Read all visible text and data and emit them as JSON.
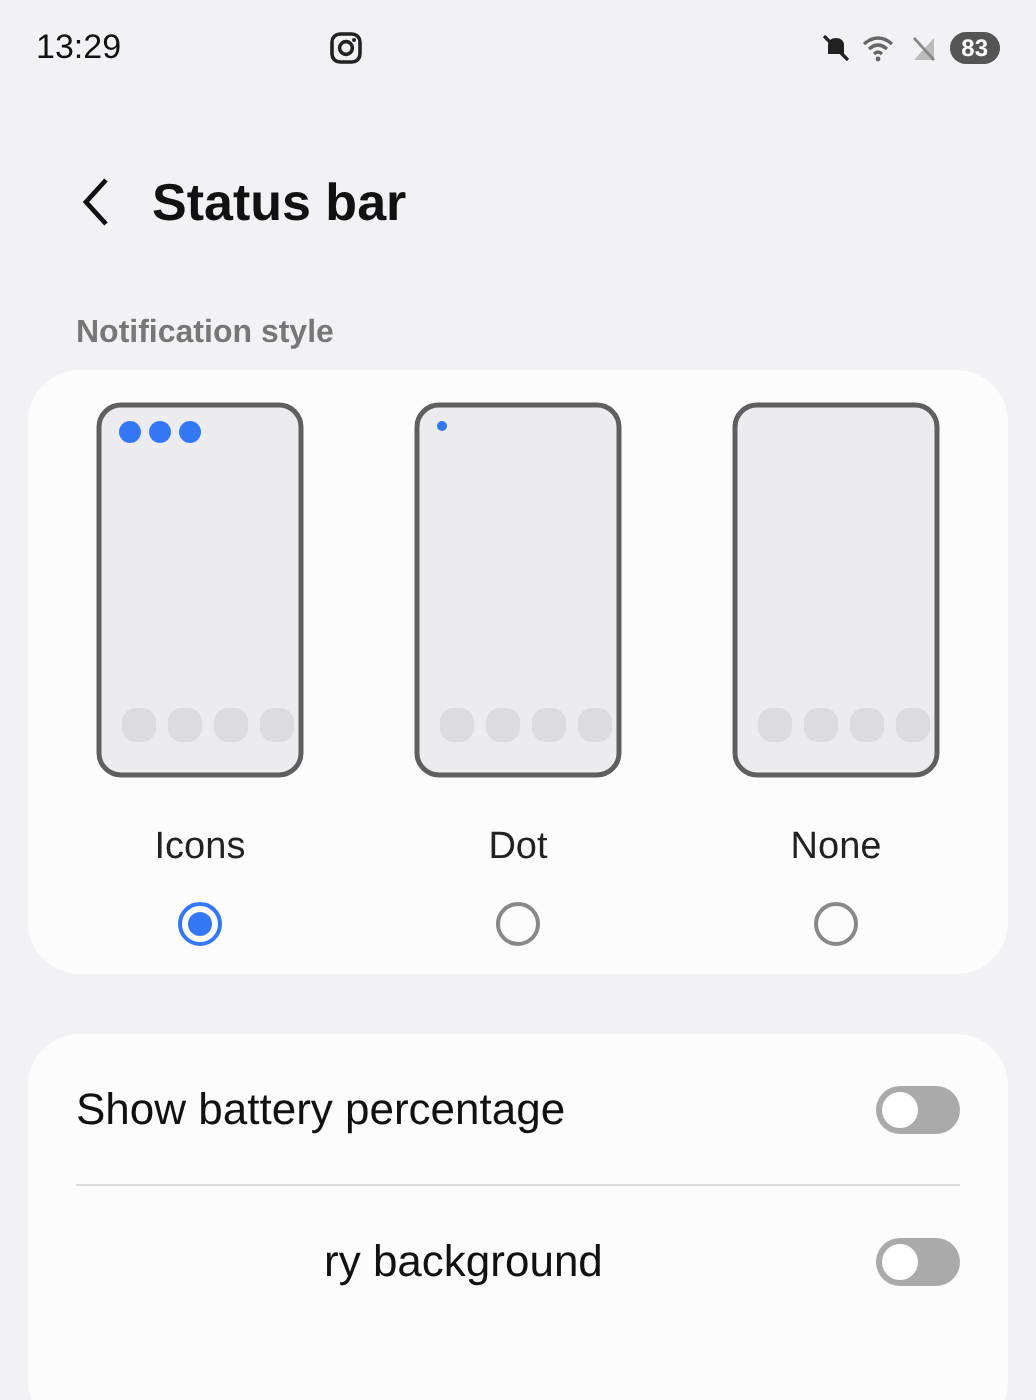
{
  "status_bar": {
    "time": "13:29",
    "battery": "83"
  },
  "header": {
    "title": "Status bar"
  },
  "notification_style": {
    "label": "Notification style",
    "options": [
      {
        "label": "Icons",
        "kind": "icons",
        "selected": true
      },
      {
        "label": "Dot",
        "kind": "dot",
        "selected": false
      },
      {
        "label": "None",
        "kind": "none",
        "selected": false
      }
    ]
  },
  "settings": [
    {
      "label": "Show battery percentage",
      "on": false
    },
    {
      "label": "ry background",
      "on": false
    }
  ]
}
